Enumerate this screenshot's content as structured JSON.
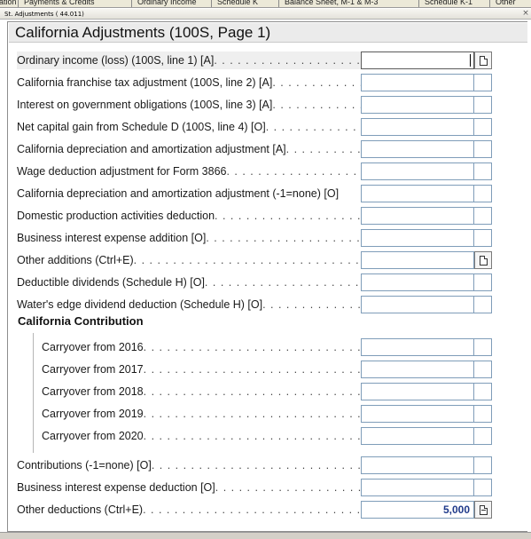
{
  "tabs": [
    "ation",
    "Payments & Credits",
    "Ordinary Income",
    "Schedule K",
    "Balance Sheet, M-1 & M-3",
    "Schedule K-1",
    "Other"
  ],
  "window": {
    "title": "St. Adjustments  ( 44.011)",
    "close_glyph": "×"
  },
  "form": {
    "title": "California Adjustments (100S, Page 1)",
    "dots": ". . . . . . . . . . . . . . . . . . . . . . . . . . . . . . . . . . . . . . . .",
    "rows": [
      {
        "label": "Ordinary income (loss) (100S, line 1) [A]",
        "value": "",
        "side_icon": "document-icon"
      },
      {
        "label": "California franchise tax adjustment (100S, line 2) [A]",
        "value": ""
      },
      {
        "label": "Interest on government obligations (100S, line 3) [A]",
        "value": ""
      },
      {
        "label": "Net capital gain from Schedule D (100S, line 4) [O]",
        "value": ""
      },
      {
        "label": "California depreciation and amortization adjustment [A]",
        "value": ""
      },
      {
        "label": "Wage deduction adjustment for Form 3866",
        "value": ""
      },
      {
        "label": "California depreciation and amortization adjustment (-1=none) [O]",
        "value": ""
      },
      {
        "label": "Domestic production activities deduction",
        "value": ""
      },
      {
        "label": "Business interest expense addition [O]",
        "value": ""
      },
      {
        "label": "Other additions (Ctrl+E)",
        "value": "",
        "side_icon": "document-icon"
      },
      {
        "label": "Deductible dividends (Schedule H) [O]",
        "value": ""
      },
      {
        "label": "Water's edge dividend deduction (Schedule H) [O]",
        "value": ""
      }
    ],
    "contribution_section": {
      "title": "California Contribution",
      "rows": [
        {
          "label": "Carryover from 2016",
          "value": ""
        },
        {
          "label": "Carryover from 2017",
          "value": ""
        },
        {
          "label": "Carryover from 2018",
          "value": ""
        },
        {
          "label": "Carryover from 2019",
          "value": ""
        },
        {
          "label": "Carryover from 2020",
          "value": ""
        }
      ]
    },
    "bottom_rows": [
      {
        "label": "Contributions (-1=none) [O]",
        "value": ""
      },
      {
        "label": "Business interest expense deduction [O]",
        "value": ""
      },
      {
        "label": "Other deductions (Ctrl+E)",
        "value": "5,000",
        "side_icon": "document-lines-icon"
      }
    ]
  }
}
